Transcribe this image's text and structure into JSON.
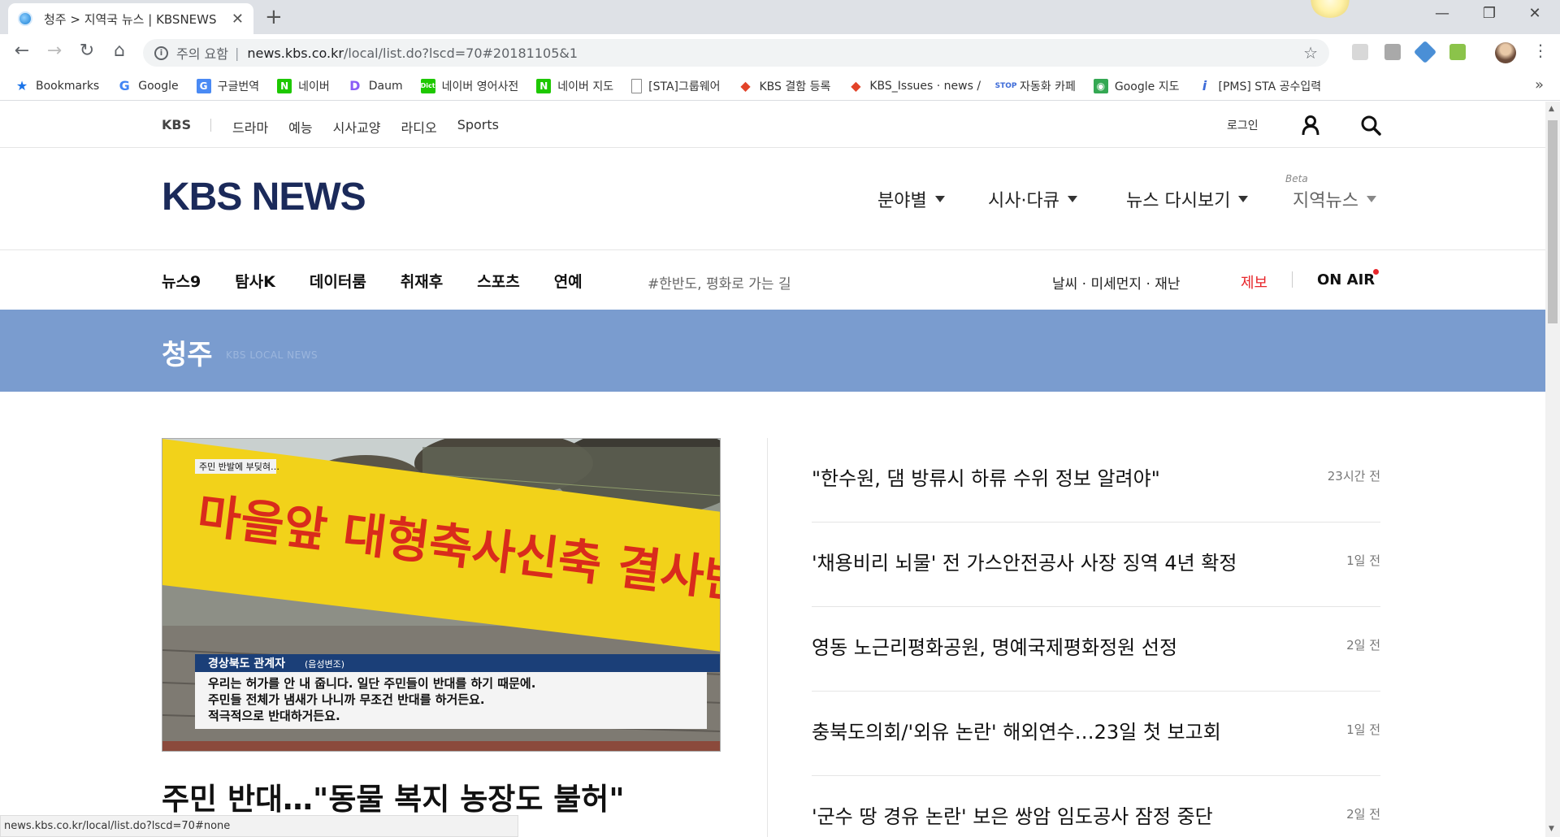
{
  "browser": {
    "tab_title": "청주 > 지역국 뉴스 | KBSNEWS",
    "omnibox": {
      "security_label": "주의 요함",
      "separator": "|",
      "url_host": "news.kbs.co.kr",
      "url_path": "/local/list.do?lscd=70#20181105&1"
    },
    "bookmarks": [
      {
        "label": "Bookmarks",
        "icon": "star-icon"
      },
      {
        "label": "Google",
        "icon": "google-icon"
      },
      {
        "label": "구글번역",
        "icon": "translate-icon"
      },
      {
        "label": "네이버",
        "icon": "naver-icon"
      },
      {
        "label": "Daum",
        "icon": "daum-icon"
      },
      {
        "label": "네이버 영어사전",
        "icon": "dict-icon"
      },
      {
        "label": "네이버 지도",
        "icon": "naver-icon"
      },
      {
        "label": "[STA]그룹웨어",
        "icon": "page-icon"
      },
      {
        "label": "KBS 결함 등록",
        "icon": "gitlab-icon"
      },
      {
        "label": "KBS_Issues · news / ",
        "icon": "gitlab-icon"
      },
      {
        "label": "자동화 카페",
        "icon": "stop-icon"
      },
      {
        "label": "Google 지도",
        "icon": "maps-icon"
      },
      {
        "label": "[PMS] STA 공수입력",
        "icon": "pms-icon"
      }
    ],
    "status_url": "news.kbs.co.kr/local/list.do?lscd=70#none"
  },
  "gnb": {
    "brand": "KBS",
    "links": [
      "드라마",
      "예능",
      "시사교양",
      "라디오",
      "Sports"
    ],
    "login": "로그인"
  },
  "header": {
    "logo": "KBS NEWS",
    "menus": [
      "분야별",
      "시사·다큐",
      "뉴스 다시보기",
      "지역뉴스"
    ],
    "beta_label": "Beta"
  },
  "subnav": {
    "links": [
      "뉴스9",
      "탐사K",
      "데이터룸",
      "취재후",
      "스포츠",
      "연예"
    ],
    "hashtag": "#한반도, 평화로 가는 길",
    "weather": "날씨 · 미세먼지 · 재난",
    "report": "제보",
    "onair": "ON AIR"
  },
  "banner": {
    "title": "청주",
    "subtitle": "KBS LOCAL NEWS"
  },
  "feature": {
    "image": {
      "top_caption": "주민 반발에 부딪혀…",
      "banner_text": "마을앞 대형축사신축 결사반대",
      "speaker": "경상북도 관계자",
      "speaker_note": "(음성변조)",
      "quote_lines": [
        "우리는 허가를 안 내 줍니다. 일단 주민들이 반대를 하기 때문에.",
        "주민들 전체가 냄새가 나니까 무조건 반대를 하거든요.",
        "적극적으로 반대하거든요."
      ]
    },
    "title": "주민 반대…\"동물 복지 농장도 불허\""
  },
  "news_list": [
    {
      "title": "\"한수원, 댐 방류시 하류 수위 정보 알려야\"",
      "time": "23시간 전"
    },
    {
      "title": "'채용비리 뇌물' 전 가스안전공사 사장 징역 4년 확정",
      "time": "1일 전"
    },
    {
      "title": "영동 노근리평화공원, 명예국제평화정원 선정",
      "time": "2일 전"
    },
    {
      "title": "충북도의회/'외유 논란' 해외연수…23일 첫 보고회",
      "time": "1일 전"
    },
    {
      "title": "'군수 땅 경유 논란' 보은 쌍암 임도공사 잠정 중단",
      "time": "2일 전"
    }
  ],
  "colors": {
    "banner": "#7a9ccf",
    "logo": "#1b2a5a",
    "accent_red": "#e8262b"
  }
}
